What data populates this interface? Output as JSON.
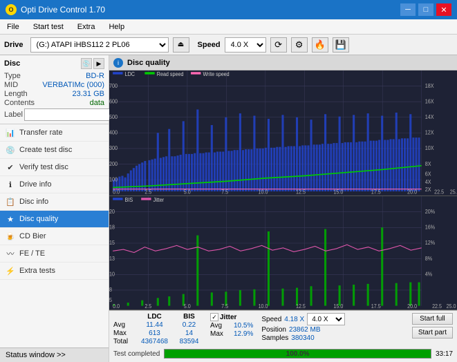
{
  "titleBar": {
    "appName": "Opti Drive Control 1.70",
    "controls": [
      "minimize",
      "maximize",
      "close"
    ]
  },
  "menuBar": {
    "items": [
      "File",
      "Start test",
      "Extra",
      "Help"
    ]
  },
  "driveBar": {
    "driveLabel": "Drive",
    "driveValue": "(G:)  ATAPI iHBS112  2 PL06",
    "speedLabel": "Speed",
    "speedValue": "4.0 X"
  },
  "disc": {
    "sectionTitle": "Disc",
    "fields": [
      {
        "key": "Type",
        "value": "BD-R"
      },
      {
        "key": "MID",
        "value": "VERBATIMc (000)"
      },
      {
        "key": "Length",
        "value": "23.31 GB"
      },
      {
        "key": "Contents",
        "value": "data"
      },
      {
        "key": "Label",
        "value": ""
      }
    ]
  },
  "navItems": [
    {
      "id": "transfer-rate",
      "label": "Transfer rate",
      "icon": "📊"
    },
    {
      "id": "create-test-disc",
      "label": "Create test disc",
      "icon": "💿"
    },
    {
      "id": "verify-test-disc",
      "label": "Verify test disc",
      "icon": "✔"
    },
    {
      "id": "drive-info",
      "label": "Drive info",
      "icon": "ℹ"
    },
    {
      "id": "disc-info",
      "label": "Disc info",
      "icon": "📋"
    },
    {
      "id": "disc-quality",
      "label": "Disc quality",
      "icon": "★",
      "active": true
    },
    {
      "id": "cd-bier",
      "label": "CD Bier",
      "icon": "🍺"
    },
    {
      "id": "fe-te",
      "label": "FE / TE",
      "icon": "〰"
    },
    {
      "id": "extra-tests",
      "label": "Extra tests",
      "icon": "⚡"
    }
  ],
  "statusWindow": "Status window >>",
  "discQuality": {
    "title": "Disc quality",
    "legend": [
      {
        "name": "LDC",
        "color": "#0000ff"
      },
      {
        "name": "Read speed",
        "color": "#00ff00"
      },
      {
        "name": "Write speed",
        "color": "#ff69b4"
      }
    ],
    "legend2": [
      {
        "name": "BIS",
        "color": "#0000ff"
      },
      {
        "name": "Jitter",
        "color": "#ff69b4"
      }
    ]
  },
  "stats": {
    "headers": [
      "LDC",
      "BIS",
      "Jitter",
      "Speed",
      ""
    ],
    "avg": {
      "ldc": "11.44",
      "bis": "0.22",
      "jitter": "10.5%"
    },
    "max": {
      "ldc": "613",
      "bis": "14",
      "jitter": "12.9%"
    },
    "total": {
      "ldc": "4367468",
      "bis": "83594"
    },
    "speed": {
      "label": "Speed",
      "value": "4.18 X",
      "selectValue": "4.0 X"
    },
    "position": {
      "label": "Position",
      "value": "23862 MB"
    },
    "samples": {
      "label": "Samples",
      "value": "380340"
    },
    "jitterChecked": true,
    "jitterLabel": "Jitter"
  },
  "buttons": {
    "startFull": "Start full",
    "startPart": "Start part"
  },
  "progressBar": {
    "percent": 100,
    "percentLabel": "100.0%",
    "time": "33:17"
  },
  "statusText": "Test completed"
}
